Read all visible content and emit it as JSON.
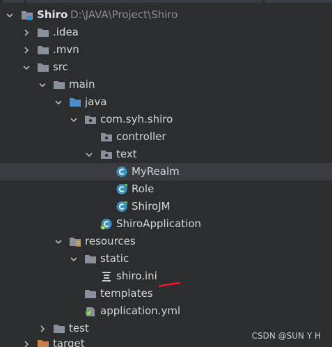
{
  "project": {
    "name": "Shiro",
    "path": "D:\\JAVA\\Project\\Shiro"
  },
  "tree": {
    "idea": ".idea",
    "mvn": ".mvn",
    "src": "src",
    "main": "main",
    "java": "java",
    "package": "com.syh.shiro",
    "controller": "controller",
    "text": "text",
    "myrealm": "MyRealm",
    "role": "Role",
    "shirojm": "ShiroJM",
    "shiroapp": "ShiroApplication",
    "resources": "resources",
    "static": "static",
    "shiroini": "shiro.ini",
    "templates": "templates",
    "appyml": "application.yml",
    "test": "test",
    "target": "target"
  },
  "watermark": "CSDN @SUN Y H",
  "colors": {
    "background": "#2b2d30",
    "selected_row": "#393c41",
    "folder": "#8a9099",
    "source_folder": "#4f8dc9",
    "resource_folder": "#8a9099",
    "class_icon": "#3d92b9",
    "target_folder": "#c6814a",
    "annotation_red": "#e8192c",
    "spring_green": "#6aaf4c"
  },
  "icons": {
    "module": "module-folder-icon",
    "folder": "folder-icon",
    "source_root": "source-root-icon",
    "package": "package-icon",
    "class": "class-icon",
    "spring_class": "spring-boot-class-icon",
    "resources_root": "resources-root-icon",
    "text_file": "text-file-icon",
    "yaml_file": "spring-yaml-icon"
  }
}
